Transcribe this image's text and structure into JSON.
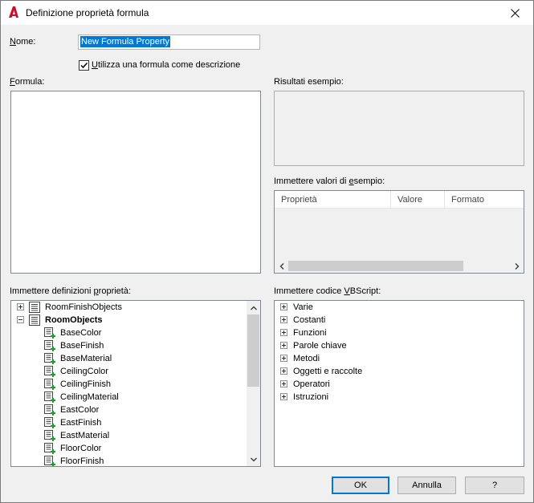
{
  "window": {
    "title": "Definizione proprietà formula",
    "close_glyph": "✕"
  },
  "name": {
    "label_u": "N",
    "label_rest": "ome:",
    "value": "New Formula Property"
  },
  "use_formula_desc": {
    "checked": true,
    "label_u": "U",
    "label_rest": "tilizza una formula come descrizione"
  },
  "formula": {
    "label_u": "F",
    "label_rest": "ormula:"
  },
  "sample_results": {
    "label": "Risultati esempio:"
  },
  "sample_values": {
    "label_pre": "Immettere valori di ",
    "label_u": "e",
    "label_post": "sempio:",
    "columns": [
      "Proprietà",
      "Valore",
      "Formato"
    ]
  },
  "property_defs": {
    "label_pre": "Immettere definizioni ",
    "label_u": "p",
    "label_post": "roprietà:",
    "tree": [
      {
        "label": "RoomFinishObjects",
        "level": 0,
        "expander": "plus",
        "bold": false
      },
      {
        "label": "RoomObjects",
        "level": 0,
        "expander": "minus",
        "bold": true
      },
      {
        "label": "BaseColor",
        "level": 1
      },
      {
        "label": "BaseFinish",
        "level": 1
      },
      {
        "label": "BaseMaterial",
        "level": 1
      },
      {
        "label": "CeilingColor",
        "level": 1
      },
      {
        "label": "CeilingFinish",
        "level": 1
      },
      {
        "label": "CeilingMaterial",
        "level": 1
      },
      {
        "label": "EastColor",
        "level": 1
      },
      {
        "label": "EastFinish",
        "level": 1
      },
      {
        "label": "EastMaterial",
        "level": 1
      },
      {
        "label": "FloorColor",
        "level": 1
      },
      {
        "label": "FloorFinish",
        "level": 1
      }
    ]
  },
  "vbscript": {
    "label_pre": "Immettere codice ",
    "label_u": "V",
    "label_post": "BScript:",
    "items": [
      "Varie",
      "Costanti",
      "Funzioni",
      "Parole chiave",
      "Metodi",
      "Oggetti e raccolte",
      "Operatori",
      "Istruzioni"
    ]
  },
  "buttons": {
    "ok": "OK",
    "cancel": "Annulla",
    "help": "?"
  },
  "colors": {
    "accent": "#0078d7",
    "brand_red": "#c8102e"
  }
}
